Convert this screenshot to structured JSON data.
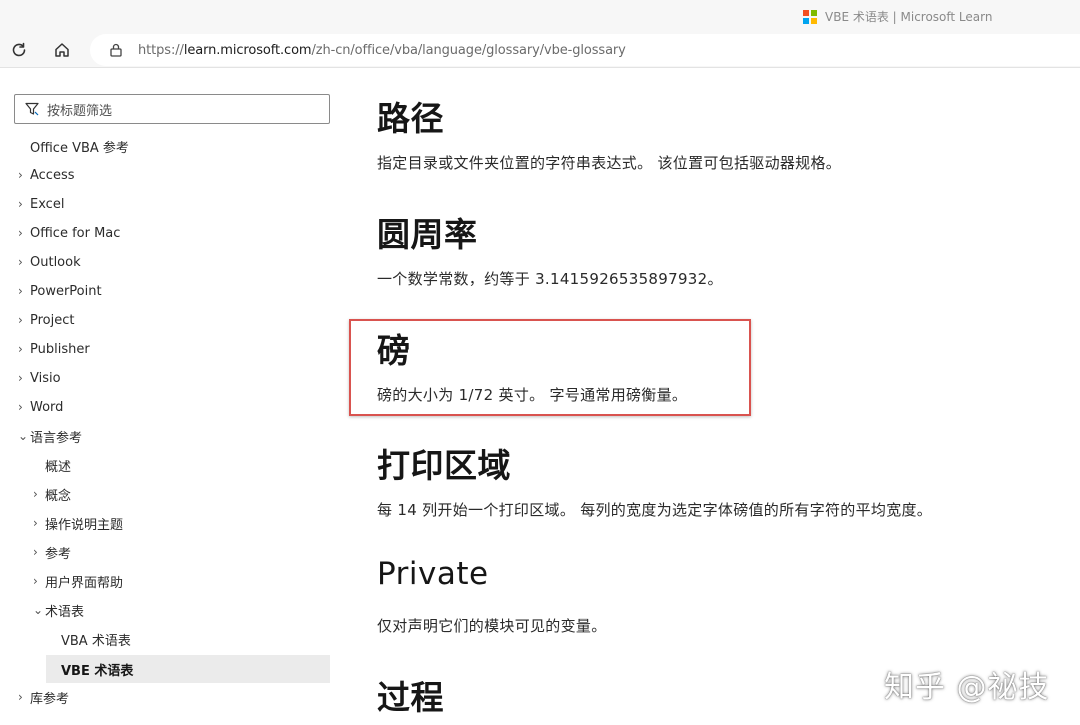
{
  "browser": {
    "tab_title": "VBE 术语表 | Microsoft Learn",
    "url_prefix": "https://",
    "url_host": "learn.microsoft.com",
    "url_path": "/zh-cn/office/vba/language/glossary/vbe-glossary",
    "icons": [
      "refresh-icon",
      "home-icon",
      "lock-icon",
      "microsoft-logo"
    ]
  },
  "sidebar": {
    "filter_placeholder": "按标题筛选",
    "items": [
      {
        "label": "Office VBA 参考",
        "chevron": ""
      },
      {
        "label": "Access",
        "chevron": "›"
      },
      {
        "label": "Excel",
        "chevron": "›"
      },
      {
        "label": "Office for Mac",
        "chevron": "›"
      },
      {
        "label": "Outlook",
        "chevron": "›"
      },
      {
        "label": "PowerPoint",
        "chevron": "›"
      },
      {
        "label": "Project",
        "chevron": "›"
      },
      {
        "label": "Publisher",
        "chevron": "›"
      },
      {
        "label": "Visio",
        "chevron": "›"
      },
      {
        "label": "Word",
        "chevron": "›"
      },
      {
        "label": "语言参考",
        "chevron": "⌄"
      },
      {
        "label": "概述",
        "chevron": ""
      },
      {
        "label": "概念",
        "chevron": "›"
      },
      {
        "label": "操作说明主题",
        "chevron": "›"
      },
      {
        "label": "参考",
        "chevron": "›"
      },
      {
        "label": "用户界面帮助",
        "chevron": "›"
      },
      {
        "label": "术语表",
        "chevron": "⌄"
      },
      {
        "label": "VBA 术语表",
        "chevron": ""
      },
      {
        "label": "VBE 术语表",
        "chevron": ""
      },
      {
        "label": "库参考",
        "chevron": "›"
      }
    ]
  },
  "main": {
    "entries": [
      {
        "term": "路径",
        "definition": "指定目录或文件夹位置的字符串表达式。 该位置可包括驱动器规格。"
      },
      {
        "term": "圆周率",
        "definition": "一个数学常数，约等于 3.1415926535897932。"
      },
      {
        "term": "磅",
        "definition": "磅的大小为 1/72 英寸。 字号通常用磅衡量。"
      },
      {
        "term": "打印区域",
        "definition": "每 14 列开始一个打印区域。 每列的宽度为选定字体磅值的所有字符的平均宽度。"
      },
      {
        "term": "Private",
        "definition": "仅对声明它们的模块可见的变量。"
      },
      {
        "term": "过程",
        "definition": ""
      }
    ]
  },
  "overlay": {
    "watermark": "知乎 @祕技",
    "highlight_color": "#d9534f"
  }
}
